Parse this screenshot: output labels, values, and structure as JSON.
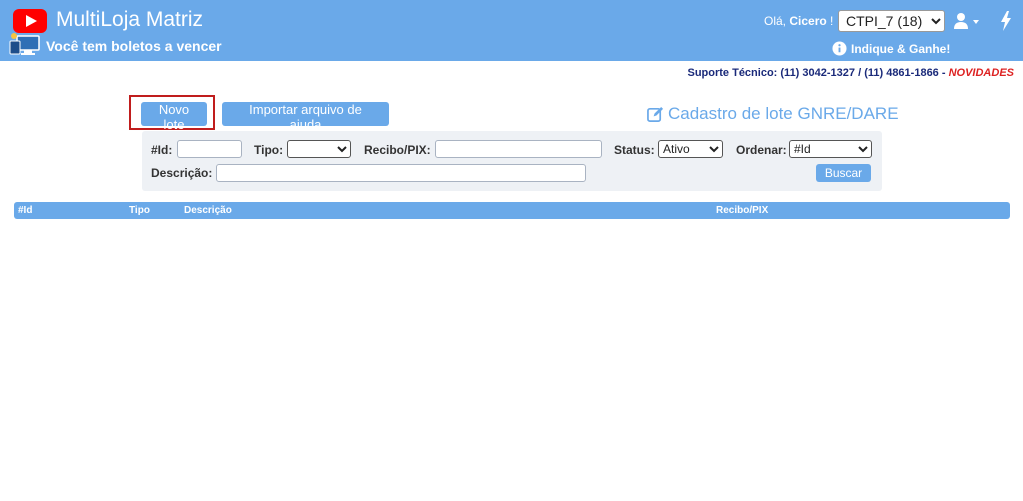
{
  "header": {
    "app_title": "MultiLoja Matriz",
    "notice": "Você tem boletos a vencer",
    "greeting_prefix": "Olá, ",
    "user_name": "Cicero",
    "greeting_suffix": " !",
    "store_selected": "CTPI_7 (18)",
    "referral": "Indique & Ganhe!"
  },
  "support": {
    "label": "Suporte Técnico: ",
    "phone1": "(11) 3042-1327",
    "sep": " / ",
    "phone2": "(11) 4861-1866",
    "dash": " - ",
    "news": "NOVIDADES"
  },
  "toolbar": {
    "new_batch": "Novo lote",
    "import_help": "Importar arquivo de ajuda",
    "page_heading": "Cadastro de lote GNRE/DARE"
  },
  "filters": {
    "id_label": "#Id:",
    "id_value": "",
    "tipo_label": "Tipo:",
    "tipo_selected": "",
    "recibo_label": "Recibo/PIX:",
    "recibo_value": "",
    "status_label": "Status:",
    "status_selected": "Ativo",
    "ordenar_label": "Ordenar:",
    "ordenar_selected": "#Id",
    "descricao_label": "Descrição:",
    "descricao_value": "",
    "search_button": "Buscar"
  },
  "table": {
    "columns": [
      "#Id",
      "Tipo",
      "Descrição",
      "Recibo/PIX"
    ]
  },
  "colors": {
    "primary": "#6aa9e9",
    "highlight": "#c01d1d",
    "support_text": "#1a2a7a",
    "news": "#dd2222"
  }
}
